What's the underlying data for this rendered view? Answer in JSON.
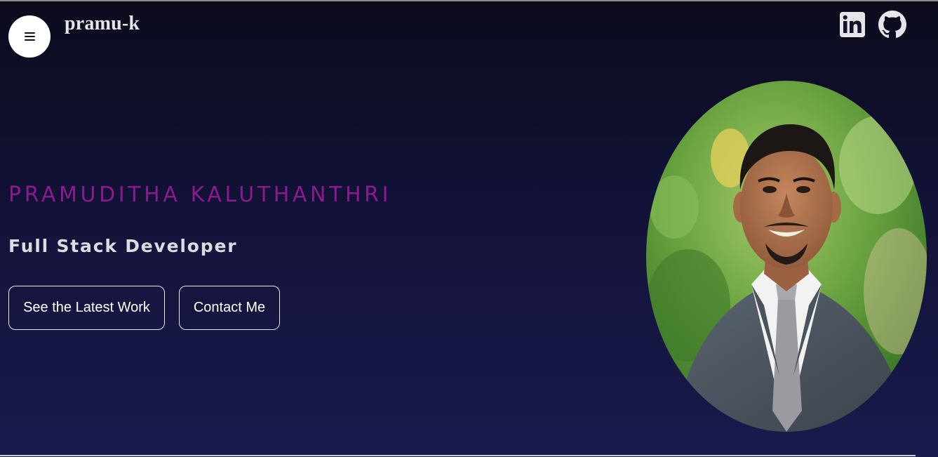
{
  "header": {
    "brand": "pramu-k",
    "menu_icon": "hamburger-menu-icon",
    "social": [
      {
        "name": "linkedin",
        "icon": "linkedin-icon"
      },
      {
        "name": "github",
        "icon": "github-icon"
      }
    ]
  },
  "hero": {
    "name": "PRAMUDITHA KALUTHANTHRI",
    "role": "Full Stack Developer",
    "buttons": {
      "work_label": "See the Latest Work",
      "contact_label": "Contact Me"
    },
    "portrait_icon": "profile-photo"
  },
  "colors": {
    "background_top": "#0b0b1c",
    "background_bottom": "#1a1a4d",
    "name_accent": "#8b1a8e",
    "text_light": "#dcdce2"
  }
}
